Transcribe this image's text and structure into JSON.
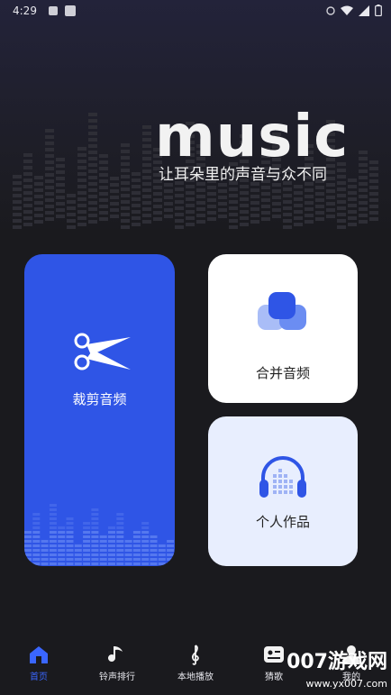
{
  "status_bar": {
    "time": "4:29"
  },
  "banner": {
    "title": "music",
    "slogan": "让耳朵里的声音与众不同"
  },
  "cards": {
    "cut": {
      "label": "裁剪音频",
      "icon": "scissors-icon"
    },
    "merge": {
      "label": "合并音频",
      "icon": "merge-blocks-icon"
    },
    "works": {
      "label": "个人作品",
      "icon": "headphones-icon"
    }
  },
  "nav": {
    "items": [
      {
        "label": "首页",
        "icon": "home-icon",
        "active": true
      },
      {
        "label": "铃声排行",
        "icon": "music-note-icon",
        "active": false
      },
      {
        "label": "本地播放",
        "icon": "treble-clef-icon",
        "active": false
      },
      {
        "label": "猜歌",
        "icon": "id-card-icon",
        "active": false
      },
      {
        "label": "我的",
        "icon": "user-icon",
        "active": false
      }
    ]
  },
  "watermark": {
    "main": "007游戏网",
    "sub": "www.yx007.com"
  },
  "colors": {
    "accent": "#2f55e6",
    "nav_active": "#3a66ff",
    "background": "#1a1a1e"
  }
}
